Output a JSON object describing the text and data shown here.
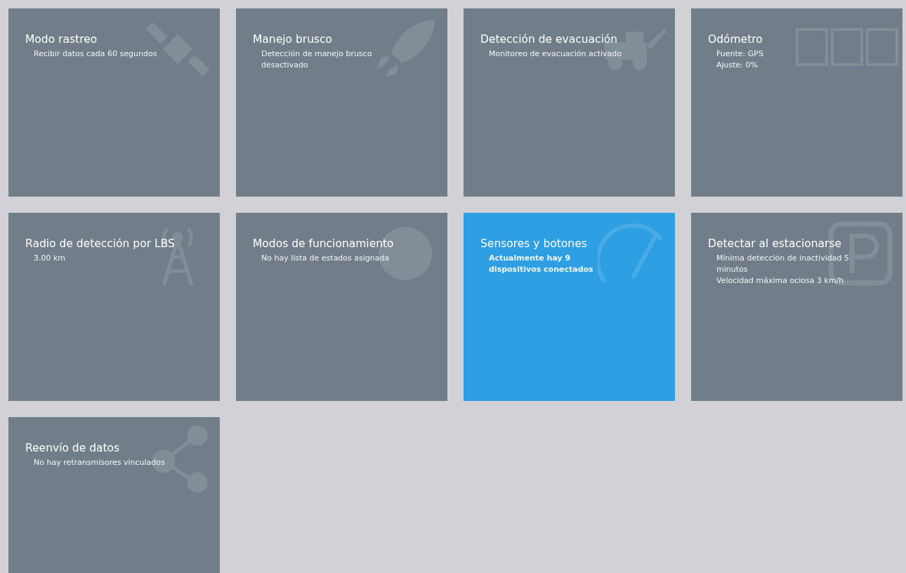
{
  "tiles": [
    {
      "title": "Modo rastreo",
      "lines": [
        "Recibir datos cada 60 segundos"
      ],
      "selected": false
    },
    {
      "title": "Manejo brusco",
      "lines": [
        "Detección de manejo brusco desactivado"
      ],
      "selected": false
    },
    {
      "title": "Detección de evacuación",
      "lines": [
        "Monitoreo de evacuación activado"
      ],
      "selected": false
    },
    {
      "title": "Odómetro",
      "lines": [
        "Fuente: GPS",
        "Ajuste: 0%"
      ],
      "selected": false
    },
    {
      "title": "Radio de detección por LBS",
      "lines": [
        "3.00 km"
      ],
      "selected": false
    },
    {
      "title": "Modos de funcionamiento",
      "lines": [
        "No hay lista de estados asignada"
      ],
      "selected": false
    },
    {
      "title": "Sensores y botones",
      "lines": [
        "Actualmente hay 9 dispositivos conectados"
      ],
      "selected": true
    },
    {
      "title": "Detectar al estacionarse",
      "lines": [
        "Mínima detección de inactividad 5 minutos",
        "Velocidad máxima ociosa 3 km/h"
      ],
      "selected": false
    },
    {
      "title": "Reenvío de datos",
      "lines": [
        "No hay retransmisores vinculados"
      ],
      "selected": false
    }
  ]
}
